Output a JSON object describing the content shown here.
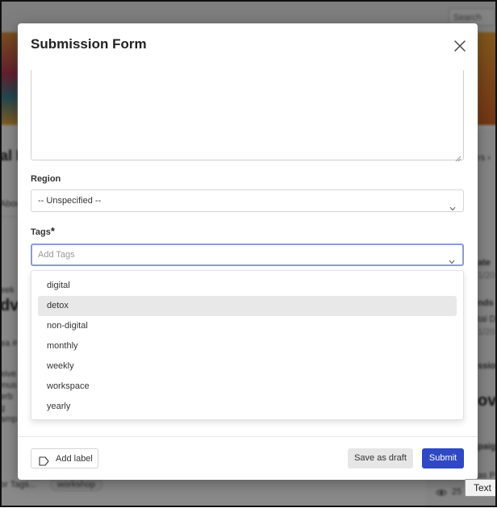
{
  "background": {
    "search_placeholder": "Search",
    "left_fragments": [
      "al I",
      "Abou",
      "eek",
      "dv",
      "ea #",
      "eive",
      "mus",
      "erb",
      "g",
      "amp"
    ],
    "right_fragments": [
      "rs ›",
      "ate",
      "1/20",
      "nds",
      "tal D",
      "1/20",
      "ssion",
      "ov 2",
      "paig",
      "as P"
    ],
    "bottom_tag_left": "or Tags...",
    "bottom_tag_pill": "workshop",
    "views_count": "25"
  },
  "modal": {
    "title": "Submission Form",
    "region": {
      "label": "Region",
      "value": "-- Unspecified --"
    },
    "tags": {
      "label": "Tags",
      "required_mark": "*",
      "placeholder": "Add Tags",
      "options": [
        {
          "label": "digital"
        },
        {
          "label": "detox"
        },
        {
          "label": "non-digital"
        },
        {
          "label": "monthly"
        },
        {
          "label": "weekly"
        },
        {
          "label": "workspace"
        },
        {
          "label": "yearly"
        }
      ],
      "highlighted_option": "detox"
    },
    "footer": {
      "add_label": "Add label",
      "save_draft": "Save as draft",
      "submit": "Submit"
    }
  },
  "tooltip": "Text",
  "colors": {
    "primary": "#2f48c4",
    "focus_border": "#8c9bd6",
    "highlight": "#e8e8e8"
  },
  "icons": {
    "close": "close-icon",
    "chevron": "chevron-down-icon",
    "label": "tag-icon",
    "eye": "eye-icon"
  }
}
